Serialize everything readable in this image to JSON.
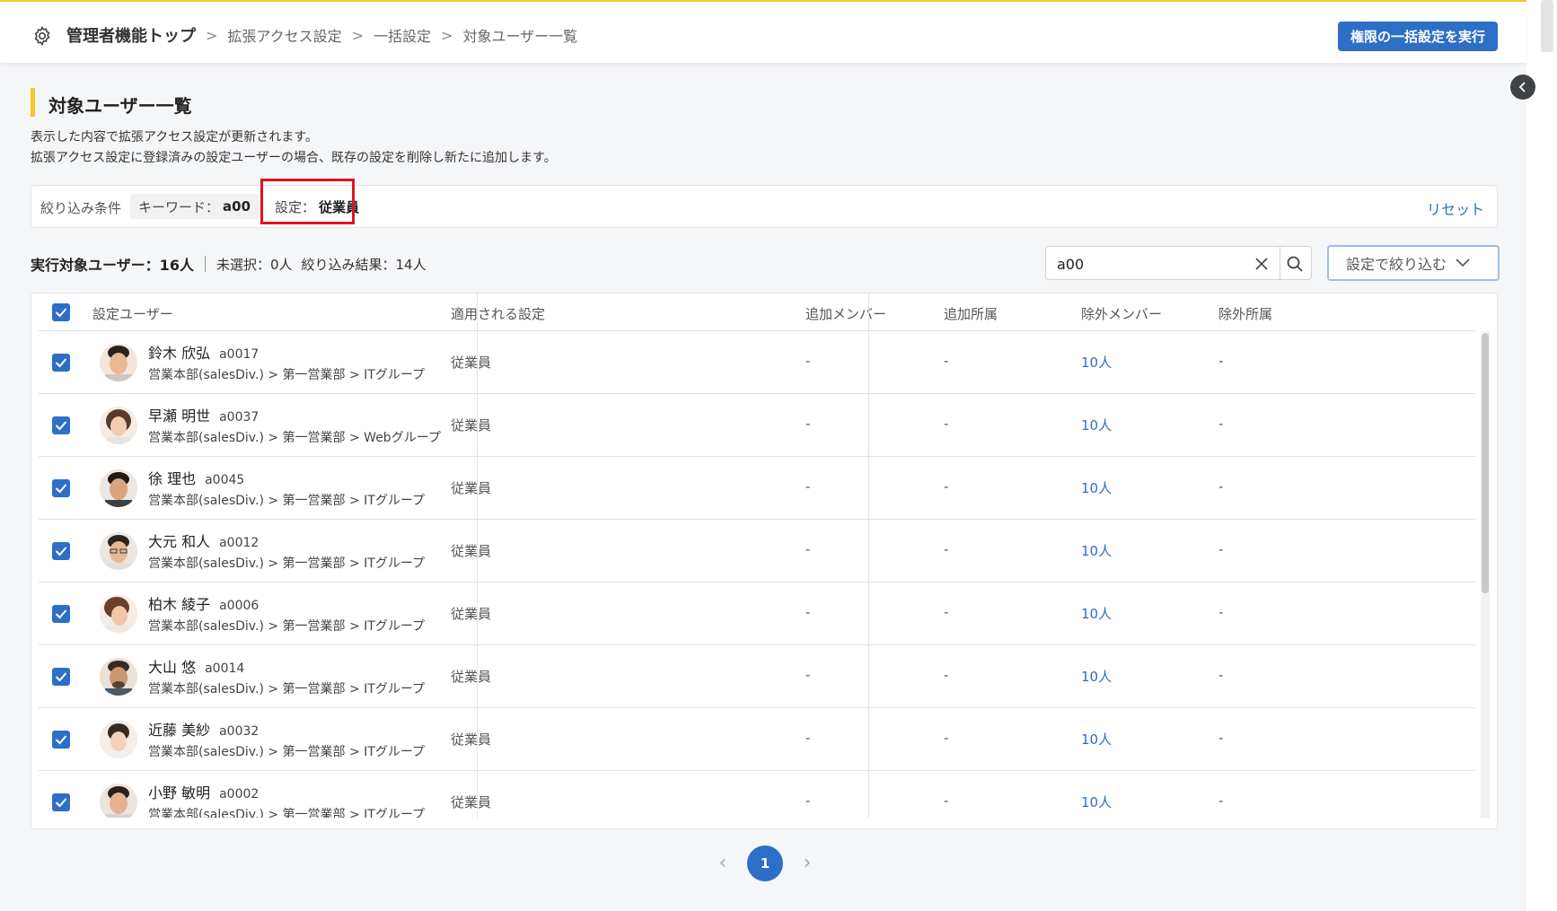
{
  "header": {
    "breadcrumb_root": "管理者機能トップ",
    "breadcrumb_items": [
      "拡張アクセス設定",
      "一括設定",
      "対象ユーザー一覧"
    ],
    "separator": ">",
    "exec_button": "権限の一括設定を実行"
  },
  "page": {
    "title": "対象ユーザー一覧",
    "desc1": "表示した内容で拡張アクセス設定が更新されます。",
    "desc2": "拡張アクセス設定に登録済みの設定ユーザーの場合、既存の設定を削除し新たに追加します。"
  },
  "filter": {
    "label": "絞り込み条件",
    "keyword_label": "キーワード：",
    "keyword_value": "a00",
    "setting_label": "設定：",
    "setting_value": "従業員",
    "reset": "リセット"
  },
  "summary": {
    "total": "実行対象ユーザー：16人",
    "unselected": "未選択：0人",
    "results": "絞り込み結果：14人"
  },
  "search": {
    "value": "a00"
  },
  "filter_dropdown": {
    "label": "設定で絞り込む"
  },
  "table": {
    "columns": [
      "設定ユーザー",
      "適用される設定",
      "追加メンバー",
      "追加所属",
      "除外メンバー",
      "除外所属"
    ],
    "rows": [
      {
        "name": "鈴木 欣弘",
        "id": "a0017",
        "dept": "営業本部(salesDiv.) > 第一営業部 > ITグループ",
        "setting": "従業員",
        "add_member": "-",
        "add_dept": "-",
        "ex_member": "10人",
        "ex_dept": "-"
      },
      {
        "name": "早瀬 明世",
        "id": "a0037",
        "dept": "営業本部(salesDiv.) > 第一営業部 > Webグループ",
        "setting": "従業員",
        "add_member": "-",
        "add_dept": "-",
        "ex_member": "10人",
        "ex_dept": "-"
      },
      {
        "name": "徐 理也",
        "id": "a0045",
        "dept": "営業本部(salesDiv.) > 第一営業部 > ITグループ",
        "setting": "従業員",
        "add_member": "-",
        "add_dept": "-",
        "ex_member": "10人",
        "ex_dept": "-"
      },
      {
        "name": "大元 和人",
        "id": "a0012",
        "dept": "営業本部(salesDiv.) > 第一営業部 > ITグループ",
        "setting": "従業員",
        "add_member": "-",
        "add_dept": "-",
        "ex_member": "10人",
        "ex_dept": "-"
      },
      {
        "name": "柏木 綾子",
        "id": "a0006",
        "dept": "営業本部(salesDiv.) > 第一営業部 > ITグループ",
        "setting": "従業員",
        "add_member": "-",
        "add_dept": "-",
        "ex_member": "10人",
        "ex_dept": "-"
      },
      {
        "name": "大山 悠",
        "id": "a0014",
        "dept": "営業本部(salesDiv.) > 第一営業部 > ITグループ",
        "setting": "従業員",
        "add_member": "-",
        "add_dept": "-",
        "ex_member": "10人",
        "ex_dept": "-"
      },
      {
        "name": "近藤 美紗",
        "id": "a0032",
        "dept": "営業本部(salesDiv.) > 第一営業部 > ITグループ",
        "setting": "従業員",
        "add_member": "-",
        "add_dept": "-",
        "ex_member": "10人",
        "ex_dept": "-"
      },
      {
        "name": "小野 敏明",
        "id": "a0002",
        "dept": "営業本部(salesDiv.) > 第一営業部 > ITグループ",
        "setting": "従業員",
        "add_member": "-",
        "add_dept": "-",
        "ex_member": "10人",
        "ex_dept": "-"
      }
    ]
  },
  "pagination": {
    "current": "1",
    "prev": "‹",
    "next": "›"
  },
  "colors": {
    "accent": "#2d6ec7",
    "highlight": "#e0141e",
    "title_bar": "#f3c62b"
  }
}
